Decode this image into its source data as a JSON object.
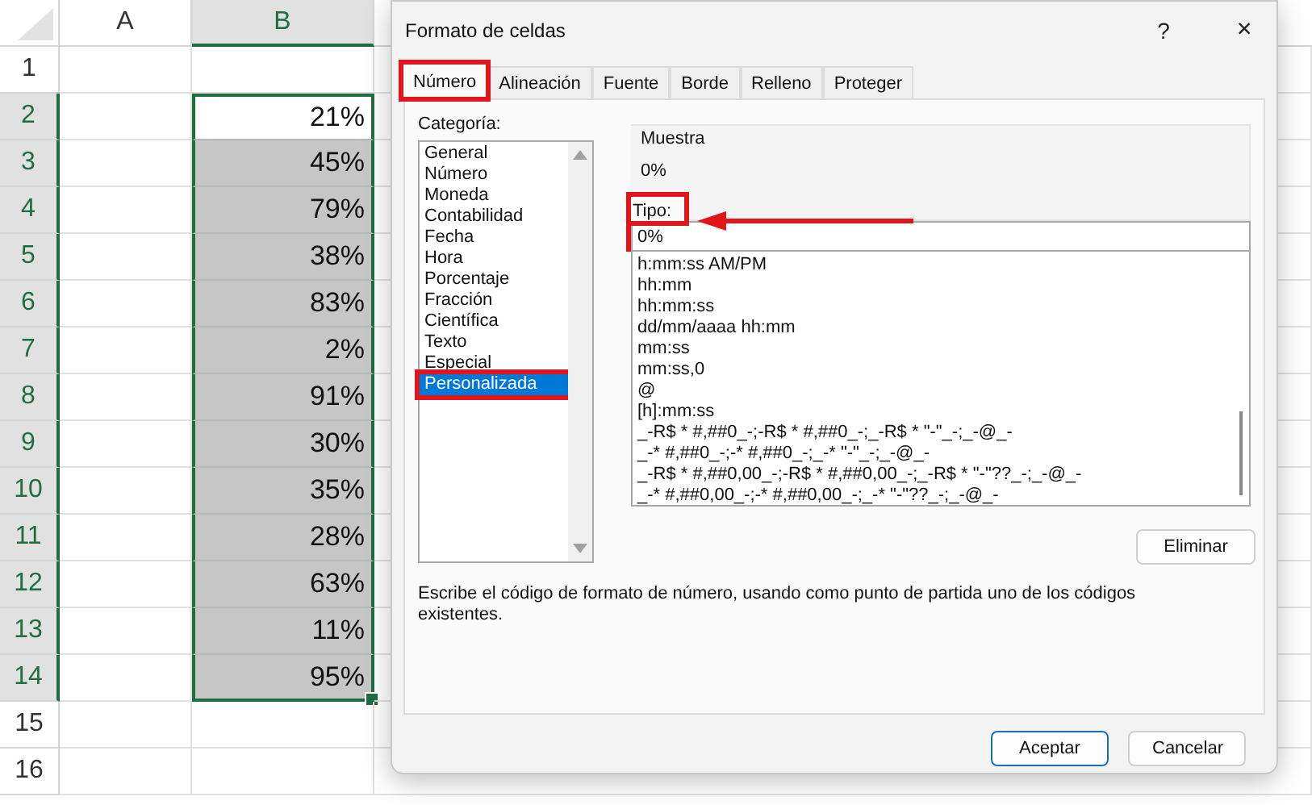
{
  "sheet": {
    "columns": [
      {
        "label": "A",
        "selected": false
      },
      {
        "label": "B",
        "selected": true
      }
    ],
    "rows": [
      {
        "header": "1",
        "selected": false,
        "active": false
      },
      {
        "header": "2",
        "b": "21%",
        "selected": true,
        "active": true
      },
      {
        "header": "3",
        "b": "45%",
        "selected": true,
        "active": false
      },
      {
        "header": "4",
        "b": "79%",
        "selected": true,
        "active": false
      },
      {
        "header": "5",
        "b": "38%",
        "selected": true,
        "active": false
      },
      {
        "header": "6",
        "b": "83%",
        "selected": true,
        "active": false
      },
      {
        "header": "7",
        "b": "2%",
        "selected": true,
        "active": false
      },
      {
        "header": "8",
        "b": "91%",
        "selected": true,
        "active": false
      },
      {
        "header": "9",
        "b": "30%",
        "selected": true,
        "active": false
      },
      {
        "header": "10",
        "b": "35%",
        "selected": true,
        "active": false
      },
      {
        "header": "11",
        "b": "28%",
        "selected": true,
        "active": false
      },
      {
        "header": "12",
        "b": "63%",
        "selected": true,
        "active": false
      },
      {
        "header": "13",
        "b": "11%",
        "selected": true,
        "active": false
      },
      {
        "header": "14",
        "b": "95%",
        "selected": true,
        "active": false
      },
      {
        "header": "15",
        "selected": false,
        "active": false
      },
      {
        "header": "16",
        "selected": false,
        "active": false
      }
    ]
  },
  "dialog": {
    "title": "Formato de celdas",
    "help": "?",
    "close": "×",
    "tabs": [
      {
        "label": "Número",
        "selected": true,
        "highlighted": true
      },
      {
        "label": "Alineación",
        "selected": false,
        "highlighted": false
      },
      {
        "label": "Fuente",
        "selected": false,
        "highlighted": false
      },
      {
        "label": "Borde",
        "selected": false,
        "highlighted": false
      },
      {
        "label": "Relleno",
        "selected": false,
        "highlighted": false
      },
      {
        "label": "Proteger",
        "selected": false,
        "highlighted": false
      }
    ],
    "category_label": "Categoría:",
    "categories": [
      {
        "label": "General",
        "selected": false,
        "highlighted": false
      },
      {
        "label": "Número",
        "selected": false,
        "highlighted": false
      },
      {
        "label": "Moneda",
        "selected": false,
        "highlighted": false
      },
      {
        "label": "Contabilidad",
        "selected": false,
        "highlighted": false
      },
      {
        "label": "Fecha",
        "selected": false,
        "highlighted": false
      },
      {
        "label": "Hora",
        "selected": false,
        "highlighted": false
      },
      {
        "label": "Porcentaje",
        "selected": false,
        "highlighted": false
      },
      {
        "label": "Fracción",
        "selected": false,
        "highlighted": false
      },
      {
        "label": "Científica",
        "selected": false,
        "highlighted": false
      },
      {
        "label": "Texto",
        "selected": false,
        "highlighted": false
      },
      {
        "label": "Especial",
        "selected": false,
        "highlighted": false
      },
      {
        "label": "Personalizada",
        "selected": true,
        "highlighted": true
      }
    ],
    "sample": {
      "label": "Muestra",
      "value": "0%"
    },
    "type": {
      "label": "Tipo:",
      "value": "0%",
      "highlighted": true
    },
    "formats": [
      "h:mm:ss AM/PM",
      "hh:mm",
      "hh:mm:ss",
      "dd/mm/aaaa hh:mm",
      "mm:ss",
      "mm:ss,0",
      "@",
      "[h]:mm:ss",
      "_-R$ * #,##0_-;-R$ * #,##0_-;_-R$ * \"-\"_-;_-@_-",
      "_-* #,##0_-;-* #,##0_-;_-* \"-\"_-;_-@_-",
      "_-R$ * #,##0,00_-;-R$ * #,##0,00_-;_-R$ * \"-\"??_-;_-@_-",
      "_-* #,##0,00_-;-* #,##0,00_-;_-* \"-\"??_-;_-@_-"
    ],
    "delete_button": "Eliminar",
    "description": "Escribe el código de formato de número, usando como punto de partida uno de los códigos existentes.",
    "buttons": [
      {
        "label": "Aceptar",
        "default": true
      },
      {
        "label": "Cancelar",
        "default": false
      }
    ]
  }
}
